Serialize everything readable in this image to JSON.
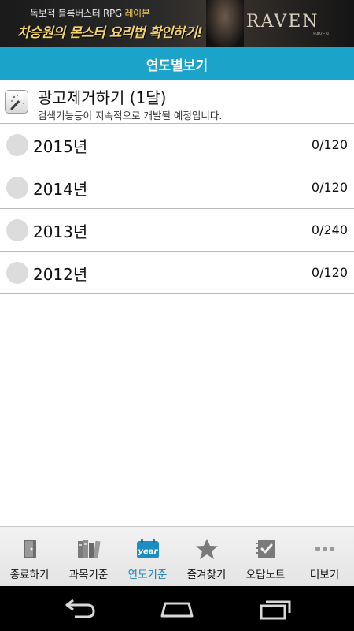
{
  "ad": {
    "line1_prefix": "독보적 블록버스터 RPG ",
    "line1_accent": "레이븐",
    "line2": "차승원의 몬스터 요리법 확인하기!",
    "logo": "RAVEN",
    "logo_sub": "RAVEN"
  },
  "header": {
    "title": "연도별보기"
  },
  "promo": {
    "title": "광고제거하기 (1달)",
    "subtitle": "검색기능등이 지속적으로 개발될 예정입니다."
  },
  "years": [
    {
      "label": "2015년",
      "count": "0/120"
    },
    {
      "label": "2014년",
      "count": "0/120"
    },
    {
      "label": "2013년",
      "count": "0/240"
    },
    {
      "label": "2012년",
      "count": "0/120"
    }
  ],
  "tabs": [
    {
      "label": "종료하기",
      "icon": "exit-door-icon"
    },
    {
      "label": "과목기준",
      "icon": "books-icon"
    },
    {
      "label": "연도기준",
      "icon": "year-calendar-icon",
      "icon_text": "year",
      "active": true
    },
    {
      "label": "즐겨찾기",
      "icon": "star-icon"
    },
    {
      "label": "오답노트",
      "icon": "notebook-check-icon"
    },
    {
      "label": "더보기",
      "icon": "more-dots-icon"
    }
  ],
  "colors": {
    "header": "#1ba3c9",
    "active_tab": "#1b7fb0",
    "nav_bar": "#000000"
  }
}
